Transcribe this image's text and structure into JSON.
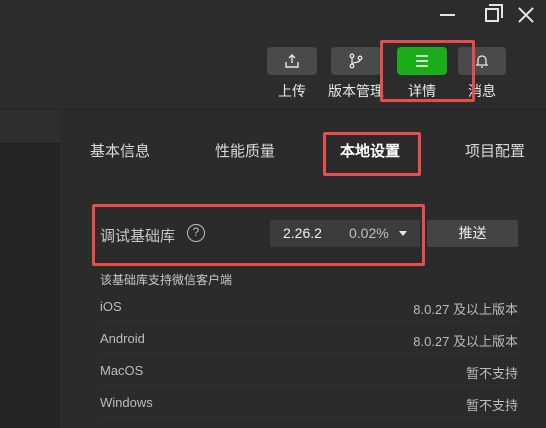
{
  "window": {
    "minimize_icon": "minimize-icon",
    "maximize_icon": "restore-icon",
    "close_icon": "close-icon"
  },
  "toolbar": {
    "upload_label": "上传",
    "version_label": "版本管理",
    "detail_label": "详情",
    "message_label": "消息",
    "icons": {
      "upload": "upload-icon",
      "version": "branch-icon",
      "detail": "menu-icon",
      "message": "bell-icon"
    },
    "active_color": "#1aad19"
  },
  "tabs": [
    {
      "label": "基本信息"
    },
    {
      "label": "性能质量"
    },
    {
      "label": "本地设置",
      "active": true
    },
    {
      "label": "项目配置"
    }
  ],
  "debug_lib": {
    "label": "调试基础库",
    "help_glyph": "?",
    "version": "2.26.2",
    "percent": "0.02%",
    "push_label": "推送"
  },
  "support": {
    "title": "该基础库支持微信客户端",
    "clients": [
      {
        "name": "iOS",
        "value": "8.0.27 及以上版本"
      },
      {
        "name": "Android",
        "value": "8.0.27 及以上版本"
      },
      {
        "name": "MacOS",
        "value": "暂不支持"
      },
      {
        "name": "Windows",
        "value": "暂不支持"
      }
    ]
  },
  "highlight_color": "#e84c4c"
}
